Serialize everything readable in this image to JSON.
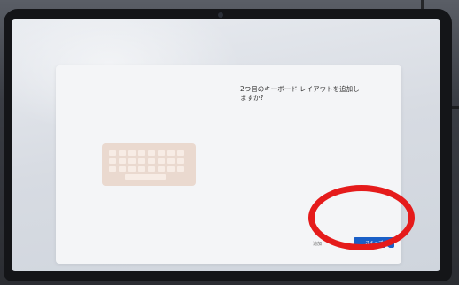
{
  "dialog": {
    "question": "2つ目のキーボード レイアウトを追加し\nますか?",
    "secondary_label": "追加",
    "skip_label": "スキップ"
  },
  "icons": {
    "illustration": "keyboard-icon",
    "pointer": "cursor-icon"
  },
  "colors": {
    "primary_button": "#1a5fc7",
    "highlight_circle": "#e51b1b"
  }
}
